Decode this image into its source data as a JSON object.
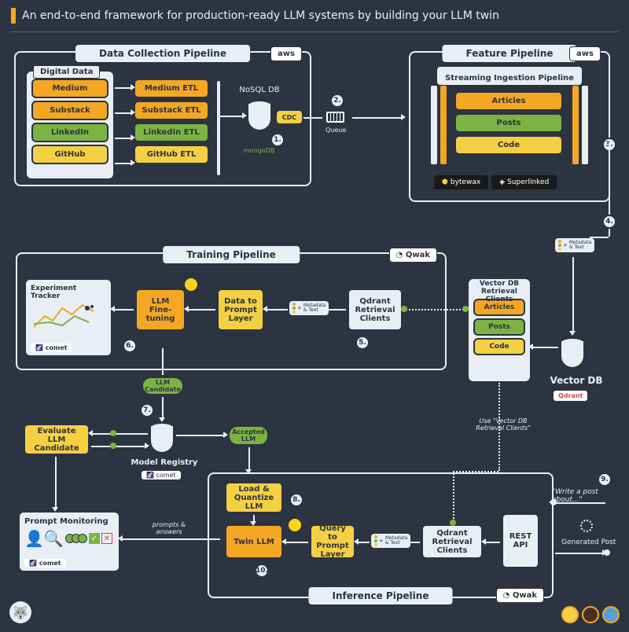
{
  "title": "An end-to-end framework for production-ready LLM systems by building your LLM twin",
  "dataCollection": {
    "title": "Data Collection Pipeline",
    "cloudBadge": "aws",
    "digitalData": {
      "label": "Digital Data",
      "sources": [
        {
          "name": "Medium",
          "color": "orange"
        },
        {
          "name": "Substack",
          "color": "orange"
        },
        {
          "name": "LinkedIn",
          "color": "green"
        },
        {
          "name": "GitHub",
          "color": "yellow"
        }
      ]
    },
    "etl": [
      {
        "name": "Medium ETL",
        "color": "orange"
      },
      {
        "name": "Substack ETL",
        "color": "orange"
      },
      {
        "name": "LinkedIn ETL",
        "color": "green"
      },
      {
        "name": "GitHub ETL",
        "color": "yellow"
      }
    ],
    "db": {
      "label": "NoSQL DB",
      "engine": "mongoDB"
    },
    "cdc": "CDC"
  },
  "queue": "Queue",
  "featurePipeline": {
    "title": "Feature Pipeline",
    "cloudBadge": "aws",
    "streaming": {
      "title": "Streaming Ingestion Pipeline",
      "categories": [
        {
          "name": "Articles",
          "color": "orange"
        },
        {
          "name": "Posts",
          "color": "green"
        },
        {
          "name": "Code",
          "color": "yellow"
        }
      ]
    },
    "brands": [
      "bytewax",
      "Superlinked"
    ]
  },
  "vectorDb": {
    "label": "Vector DB",
    "engine": "Qdrant"
  },
  "retrievalClients": {
    "label": "Vector DB Retrieval Clients",
    "items": [
      {
        "name": "Articles",
        "color": "orange"
      },
      {
        "name": "Posts",
        "color": "green"
      },
      {
        "name": "Code",
        "color": "yellow"
      }
    ]
  },
  "training": {
    "title": "Training Pipeline",
    "platformBadge": "Qwak",
    "tracker": {
      "label": "Experiment Tracker",
      "logo": "comet"
    },
    "fineTuning": "LLM Fine-tuning",
    "dataToPrompt": "Data to Prompt Layer",
    "qdrantClients": "Qdrant Retrieval Clients",
    "metadataLabel": "Metadata & Text"
  },
  "modelFlow": {
    "candidate": "LLM Candidate",
    "registry": "Model Registry",
    "registryLogo": "comet",
    "evaluate": "Evaluate LLM Candidate",
    "accepted": "Accepted LLM"
  },
  "monitoring": {
    "label": "Prompt Monitoring",
    "logo": "comet"
  },
  "inference": {
    "title": "Inference Pipeline",
    "platformBadge": "Qwak",
    "loadQuantize": "Load & Quantize LLM",
    "twinLlm": "Twin LLM",
    "queryToPrompt": "Query to Prompt Layer",
    "qdrantClients": "Qdrant Retrieval Clients",
    "restApi": "REST API",
    "metadataLabel": "Metadata & Text",
    "promptsAnswers": "prompts & answers"
  },
  "useClients": "Use \"Vector DB Retrieval Clients\"",
  "userPrompt": "\"Write a post about...\"",
  "generated": "Generated Post",
  "steps": [
    "1.",
    "2.",
    "3.",
    "4.",
    "5.",
    "6.",
    "7.",
    "8.",
    "9.",
    "10."
  ]
}
